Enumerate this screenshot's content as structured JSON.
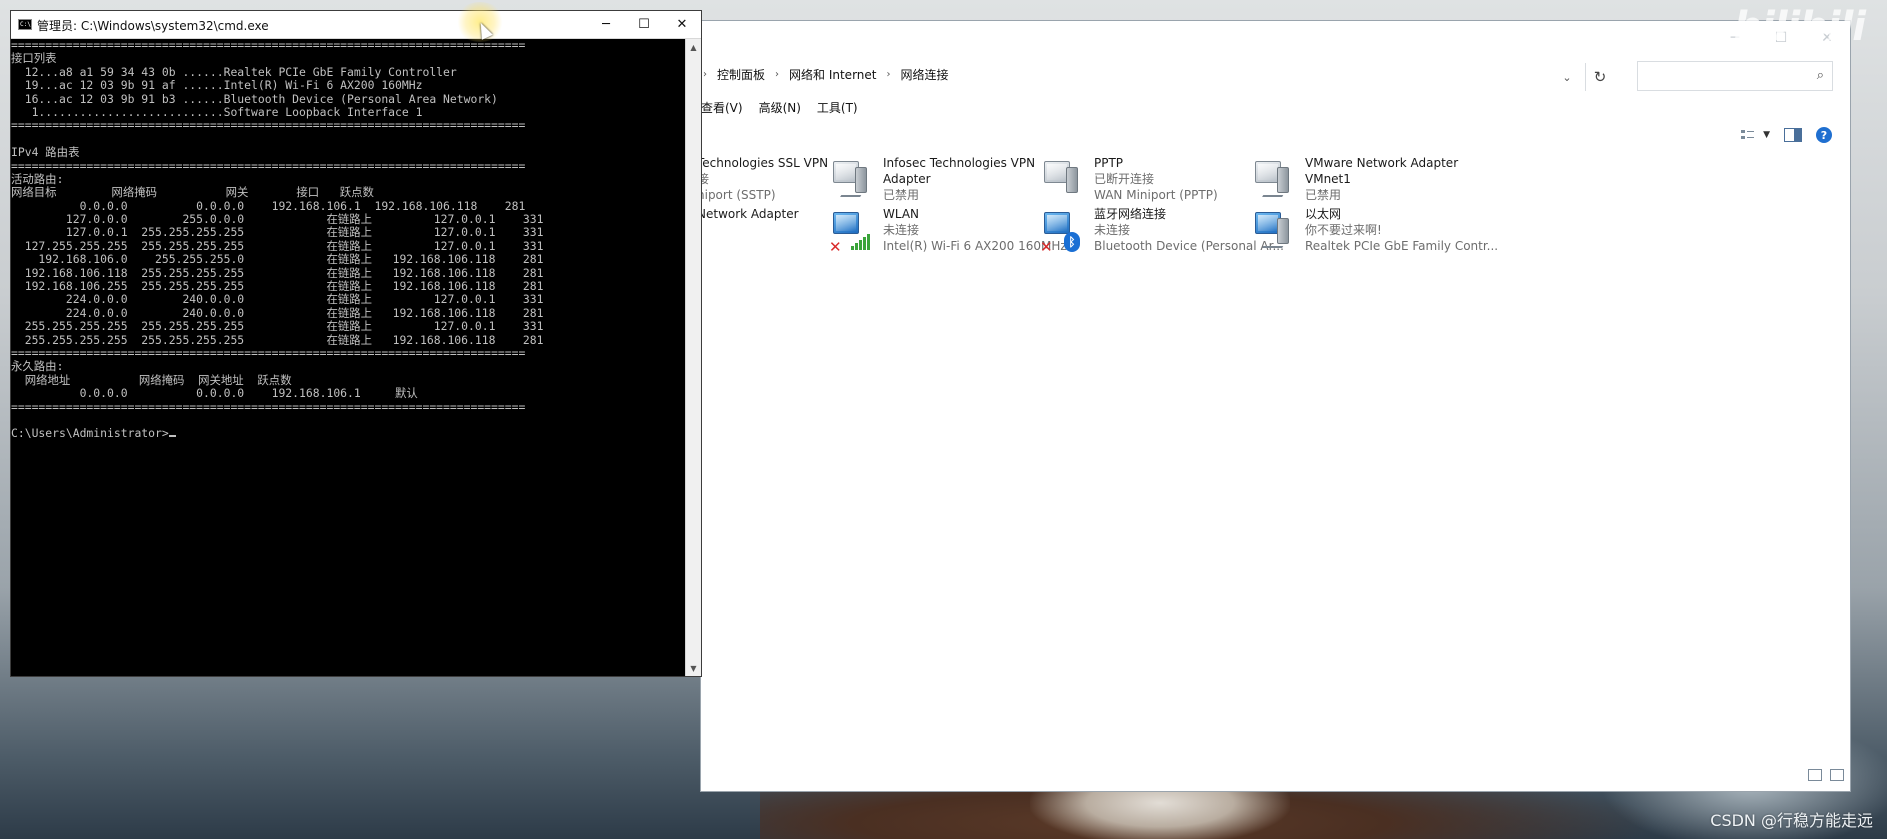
{
  "cmd": {
    "title": "管理员: C:\\Windows\\system32\\cmd.exe",
    "icon_label": "C:\\",
    "buttons": {
      "minimize": "─",
      "maximize": "☐",
      "close": "✕"
    },
    "lines": [
      "===========================================================================",
      "接口列表",
      "  12...a8 a1 59 34 43 0b ......Realtek PCIe GbE Family Controller",
      "  19...ac 12 03 9b 91 af ......Intel(R) Wi-Fi 6 AX200 160MHz",
      "  16...ac 12 03 9b 91 b3 ......Bluetooth Device (Personal Area Network)",
      "   1...........................Software Loopback Interface 1",
      "===========================================================================",
      "",
      "IPv4 路由表",
      "===========================================================================",
      "活动路由:",
      "网络目标        网络掩码          网关       接口   跃点数",
      "          0.0.0.0          0.0.0.0    192.168.106.1  192.168.106.118    281",
      "        127.0.0.0        255.0.0.0            在链路上         127.0.0.1    331",
      "        127.0.0.1  255.255.255.255            在链路上         127.0.0.1    331",
      "  127.255.255.255  255.255.255.255            在链路上         127.0.0.1    331",
      "    192.168.106.0    255.255.255.0            在链路上   192.168.106.118    281",
      "  192.168.106.118  255.255.255.255            在链路上   192.168.106.118    281",
      "  192.168.106.255  255.255.255.255            在链路上   192.168.106.118    281",
      "        224.0.0.0        240.0.0.0            在链路上         127.0.0.1    331",
      "        224.0.0.0        240.0.0.0            在链路上   192.168.106.118    281",
      "  255.255.255.255  255.255.255.255            在链路上         127.0.0.1    331",
      "  255.255.255.255  255.255.255.255            在链路上   192.168.106.118    281",
      "===========================================================================",
      "永久路由:",
      "  网络地址          网络掩码  网关地址  跃点数",
      "          0.0.0.0          0.0.0.0    192.168.106.1     默认",
      "===========================================================================",
      "",
      "C:\\Users\\Administrator>"
    ]
  },
  "explorer": {
    "window_buttons": {
      "minimize": "─",
      "maximize": "☐",
      "close": "✕"
    },
    "breadcrumb": [
      "控制面板",
      "网络和 Internet",
      "网络连接"
    ],
    "menu": [
      "查看(V)",
      "高级(N)",
      "工具(T)"
    ],
    "items": [
      {
        "name": "Technologies SSL VPN",
        "status": "接",
        "device": "niport (SSTP)",
        "icon": "vpn-adapter-icon"
      },
      {
        "name": "Infosec Technologies VPN Adapter",
        "status": "已禁用",
        "device": "",
        "icon": "vpn-adapter-icon"
      },
      {
        "name": "PPTP",
        "status": "已断开连接",
        "device": "WAN Miniport (PPTP)",
        "icon": "pptp-adapter-icon"
      },
      {
        "name": "VMware Network Adapter VMnet1",
        "status": "已禁用",
        "device": "",
        "icon": "vmware-adapter-icon"
      },
      {
        "name": "Network Adapter",
        "status": "",
        "device": "",
        "icon": "network-adapter-icon"
      },
      {
        "name": "WLAN",
        "status": "未连接",
        "device": "Intel(R) Wi-Fi 6 AX200 160MHz",
        "icon": "wlan-adapter-icon"
      },
      {
        "name": "蓝牙网络连接",
        "status": "未连接",
        "device": "Bluetooth Device (Personal Ar...",
        "icon": "bluetooth-adapter-icon"
      },
      {
        "name": "以太网",
        "status": "你不要过来啊!",
        "device": "Realtek PCIe GbE Family Contr...",
        "icon": "ethernet-adapter-icon"
      }
    ]
  },
  "watermarks": {
    "bilibili": "bilibili",
    "csdn": "CSDN @行稳方能走远"
  }
}
